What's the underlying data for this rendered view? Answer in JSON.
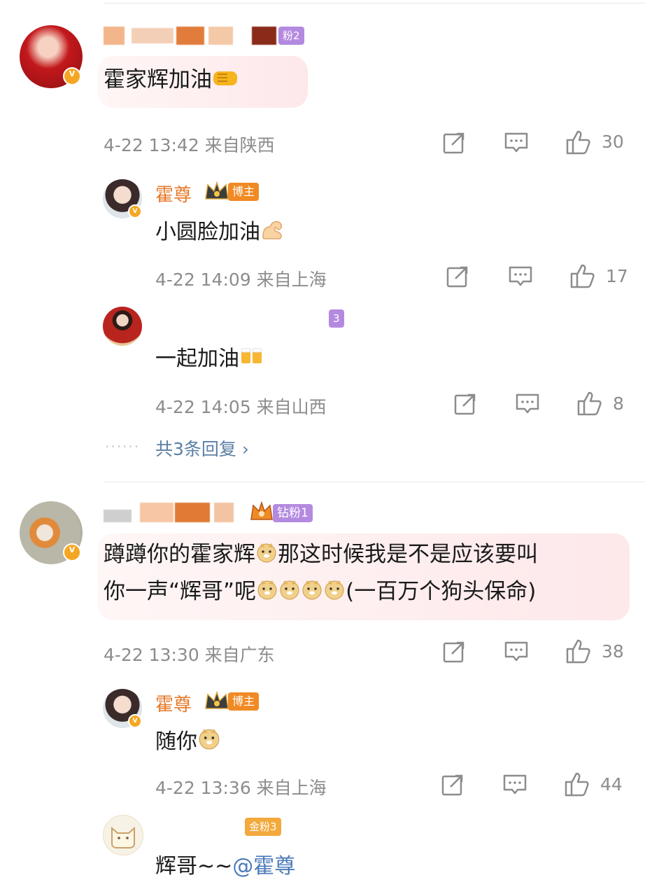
{
  "comments": [
    {
      "text": "霍家辉加油",
      "emoji": "fist-bump-emoji",
      "meta": "4-22 13:42 来自陕西",
      "likes": "30",
      "fan_badge": "粉2",
      "replies": [
        {
          "name": "霍尊",
          "badge": "博主",
          "text": "小圆脸加油",
          "emoji": "flexed-biceps-emoji",
          "meta": "4-22 14:09 来自上海",
          "likes": "17"
        },
        {
          "name": "",
          "badge": "3",
          "text": "一起加油",
          "emoji": "beer-mugs-emoji",
          "meta": "4-22 14:05 来自山西",
          "likes": "8"
        }
      ],
      "more_replies": "共3条回复 ›"
    },
    {
      "text_line1": "蹲蹲你的霍家辉",
      "text_line1b": "那这时候我是不是应该要叫",
      "text_line2a": "你一声“辉哥”呢",
      "text_line2b": "(一百万个狗头保命)",
      "meta": "4-22 13:30 来自广东",
      "likes": "38",
      "fan_badge": "钻粉1",
      "replies": [
        {
          "name": "霍尊",
          "badge": "博主",
          "text": "随你",
          "emoji": "doge-emoji",
          "meta": "4-22 13:36 来自上海",
          "likes": "44"
        },
        {
          "name": "",
          "badge": "金粉3",
          "text_prefix": "辉哥~~",
          "mention": "@霍尊"
        }
      ]
    }
  ],
  "colors": {
    "name": "#e5792a",
    "meta": "#8c8c8c",
    "link": "#5b7fa6",
    "badge_orange": "#f08a24",
    "badge_purple": "#b48ae0",
    "badge_gold": "#f3a93c"
  },
  "icons": [
    "share-icon",
    "comment-icon",
    "like-icon"
  ]
}
